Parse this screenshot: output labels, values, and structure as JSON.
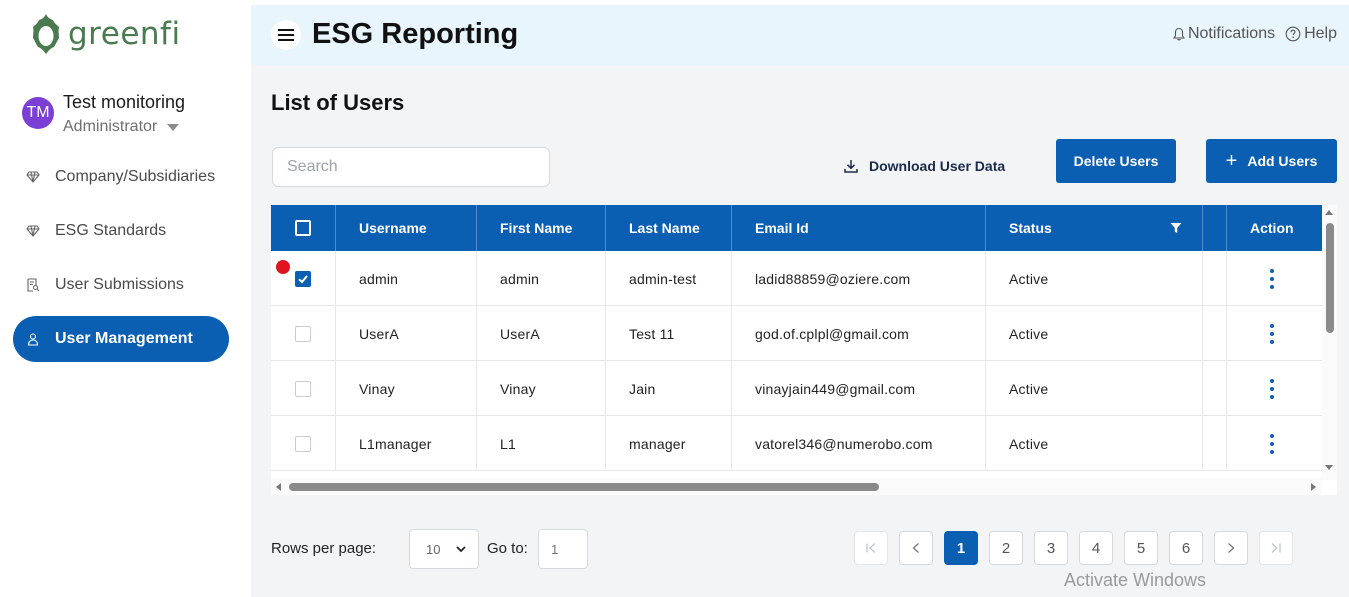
{
  "brand": {
    "name": "greenfi",
    "color": "#4a7a4f"
  },
  "user": {
    "initials": "TM",
    "name": "Test monitoring",
    "role": "Administrator"
  },
  "nav": [
    {
      "label": "Company/Subsidiaries",
      "icon": "diamond-icon",
      "active": false
    },
    {
      "label": "ESG Standards",
      "icon": "diamond-icon",
      "active": false
    },
    {
      "label": "User Submissions",
      "icon": "document-search-icon",
      "active": false
    },
    {
      "label": "User Management",
      "icon": "person-icon",
      "active": true
    }
  ],
  "header": {
    "title": "ESG Reporting",
    "notifications": "Notifications",
    "help": "Help"
  },
  "page": {
    "title": "List of Users",
    "search_placeholder": "Search",
    "download_label": "Download User Data",
    "delete_label": "Delete Users",
    "add_label": "Add Users"
  },
  "table": {
    "columns": [
      "Username",
      "First Name",
      "Last Name",
      "Email Id",
      "Status",
      "Action"
    ],
    "rows": [
      {
        "username": "admin",
        "first_name": "admin",
        "last_name": "admin-test",
        "email": "ladid88859@oziere.com",
        "status": "Active",
        "checked": true
      },
      {
        "username": "UserA",
        "first_name": "UserA",
        "last_name": "Test 11",
        "email": "god.of.cplpl@gmail.com",
        "status": "Active",
        "checked": false
      },
      {
        "username": "Vinay",
        "first_name": "Vinay",
        "last_name": "Jain",
        "email": "vinayjain449@gmail.com",
        "status": "Active",
        "checked": false
      },
      {
        "username": "L1manager",
        "first_name": "L1",
        "last_name": "manager",
        "email": "vatorel346@numerobo.com",
        "status": "Active",
        "checked": false
      }
    ]
  },
  "pagination": {
    "rows_per_page_label": "Rows per page:",
    "rows_per_page": "10",
    "goto_label": "Go to:",
    "goto_placeholder": "1",
    "pages": [
      "1",
      "2",
      "3",
      "4",
      "5",
      "6"
    ],
    "current": "1"
  },
  "watermark": "Activate Windows",
  "colors": {
    "primary": "#0b5fb3",
    "header_bg": "#e8f5fd",
    "avatar": "#7b3fd6",
    "marker": "#e0141e"
  }
}
